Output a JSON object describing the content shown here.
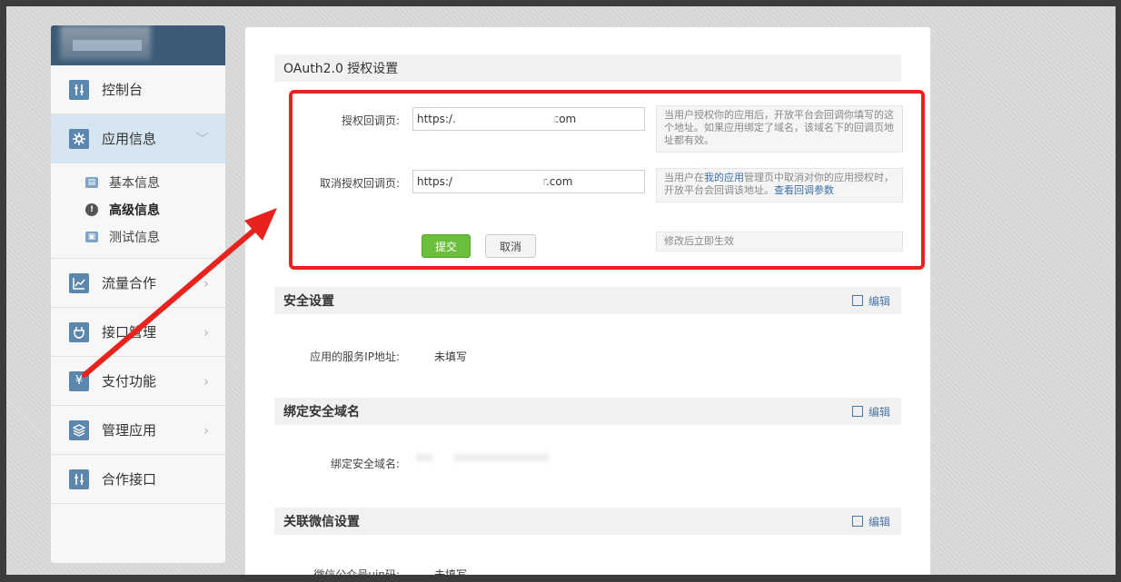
{
  "sidebar": {
    "items": [
      {
        "label": "控制台",
        "icon": "sliders-icon"
      },
      {
        "label": "应用信息",
        "icon": "gear-icon"
      },
      {
        "label": "流量合作",
        "icon": "line-chart-icon"
      },
      {
        "label": "接口管理",
        "icon": "plug-icon"
      },
      {
        "label": "支付功能",
        "icon": "yen-icon"
      },
      {
        "label": "管理应用",
        "icon": "layers-icon"
      },
      {
        "label": "合作接口",
        "icon": "sliders-icon"
      }
    ],
    "sub_items": [
      {
        "label": "基本信息",
        "icon": "card-icon"
      },
      {
        "label": "高级信息",
        "icon": "exclamation-icon"
      },
      {
        "label": "测试信息",
        "icon": "id-card-icon"
      }
    ],
    "chevron": "﹀",
    "chevron_right": "›"
  },
  "oauth": {
    "title": "OAuth2.0 授权设置",
    "callback_label": "授权回调页:",
    "callback_value": "https:/.                           .com",
    "callback_help": "当用户授权你的应用后，开放平台会回调你填写的这个地址。如果应用绑定了域名，该域名下的回调页地址都有效。",
    "cancel_label": "取消授权回调页:",
    "cancel_value": "https:/                         .r.com",
    "cancel_help_prefix": "当用户在",
    "cancel_help_link": "我的应用",
    "cancel_help_mid": "管理页中取消对你的应用授权时，开放平台会回调该地址。",
    "cancel_help_link2": "查看回调参数",
    "submit_label": "提交",
    "cancel_button_label": "取消",
    "effect_note": "修改后立即生效"
  },
  "security": {
    "title": "安全设置",
    "edit_label": "编辑",
    "ip_label": "应用的服务IP地址:",
    "ip_value": "未填写"
  },
  "domain": {
    "title": "绑定安全域名",
    "edit_label": "编辑",
    "domain_label": "绑定安全域名:"
  },
  "wechat": {
    "title": "关联微信设置",
    "edit_label": "编辑",
    "uin_label": "微信公众号uin码:",
    "uin_value": "未填写"
  },
  "colors": {
    "annotation_red": "#e8231d",
    "submit_green": "#6bbf3c",
    "nav_blue": "#5b86ad",
    "header_blue": "#3d5b78"
  }
}
